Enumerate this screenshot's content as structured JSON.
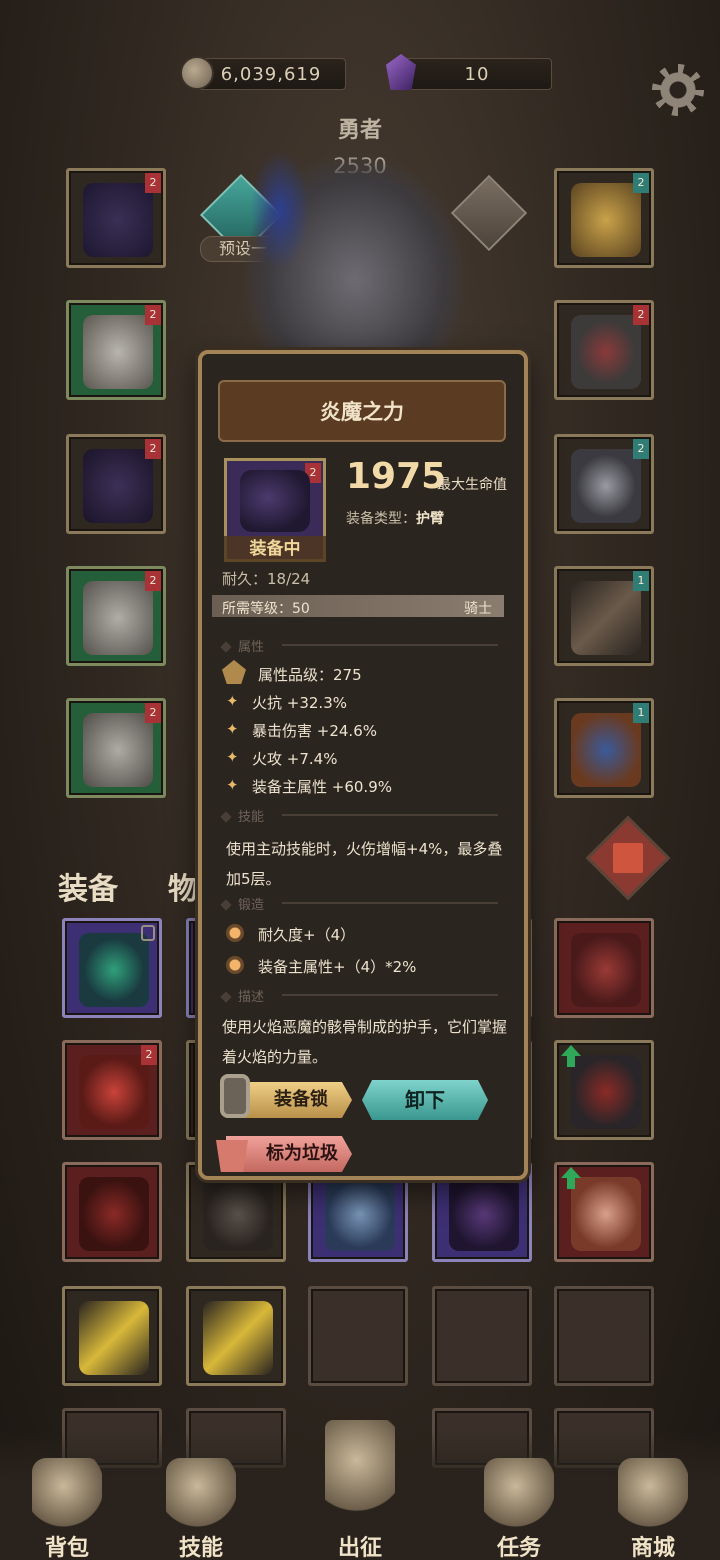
{
  "currency": {
    "gold": "6,039,619",
    "gems": "10"
  },
  "hero": {
    "title": "勇者",
    "score": "2530",
    "preset": "预设一"
  },
  "tabs": {
    "equipment": "装备",
    "items": "物品"
  },
  "tooltip": {
    "title": "炎魔之力",
    "equipped_label": "装备中",
    "item_level_badge": "2",
    "main_value": "1975",
    "main_stat": "最大生命值",
    "equip_type_label": "装备类型：",
    "equip_type": "护臂",
    "durability": "耐久：18/24",
    "required_level": "所需等级：50",
    "required_class": "骑士",
    "section_attr": "属性",
    "attr_grade": "属性品级：275",
    "attributes": [
      "火抗 +32.3%",
      "暴击伤害 +24.6%",
      "火攻 +7.4%",
      "装备主属性 +60.9%"
    ],
    "section_skill": "技能",
    "skill_text": "使用主动技能时，火伤增幅+4%，最多叠加5层。",
    "section_forge": "锻造",
    "forge": [
      "耐久度+（4）",
      "装备主属性+（4）*2%"
    ],
    "section_desc": "描述",
    "desc_text": "使用火焰恶魔的骸骨制成的护手，它们掌握着火焰的力量。",
    "btn_lock": "装备锁",
    "btn_unequip": "卸下",
    "btn_trash": "标为垃圾"
  },
  "slot_badges": {
    "two": "2",
    "one": "1"
  },
  "nav": [
    "背包",
    "技能",
    "出征",
    "任务",
    "商城"
  ],
  "colors": {
    "gold_accent": "#a38456",
    "teal_button": "#3a978f",
    "trash_button": "#c46860"
  }
}
